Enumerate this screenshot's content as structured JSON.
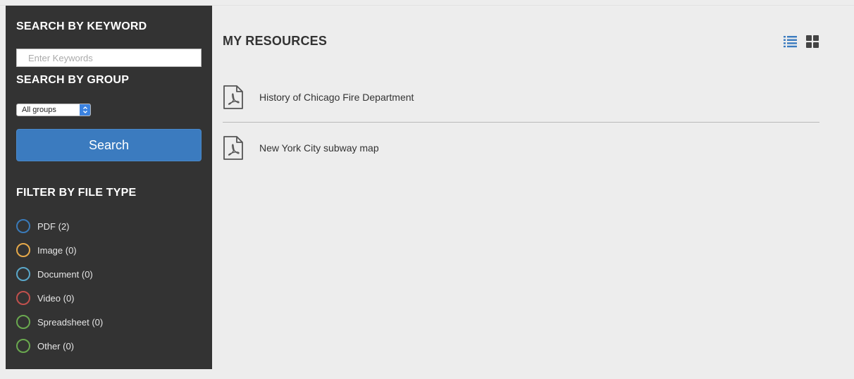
{
  "sidebar": {
    "keyword_heading": "SEARCH BY KEYWORD",
    "keyword_placeholder": "Enter Keywords",
    "group_heading": "SEARCH BY GROUP",
    "group_selected": "All groups",
    "search_button": "Search",
    "filter_heading": "FILTER BY FILE TYPE",
    "filters": [
      {
        "label": "PDF (2)",
        "color": "#3a7ab8"
      },
      {
        "label": "Image (0)",
        "color": "#e6a94a"
      },
      {
        "label": "Document (0)",
        "color": "#5aa7c9"
      },
      {
        "label": "Video (0)",
        "color": "#c0504d"
      },
      {
        "label": "Spreadsheet (0)",
        "color": "#6aa84f"
      },
      {
        "label": "Other (0)",
        "color": "#6aa84f"
      }
    ]
  },
  "main": {
    "title": "MY RESOURCES",
    "view_icons": [
      "list-view-icon",
      "grid-view-icon"
    ],
    "resources": [
      {
        "title": "History of Chicago Fire Department",
        "icon": "pdf-file-icon"
      },
      {
        "title": "New York City subway map",
        "icon": "pdf-file-icon"
      }
    ]
  },
  "colors": {
    "sidebar_bg": "#333333",
    "page_bg": "#ededed",
    "accent_blue": "#3b7bbf"
  }
}
